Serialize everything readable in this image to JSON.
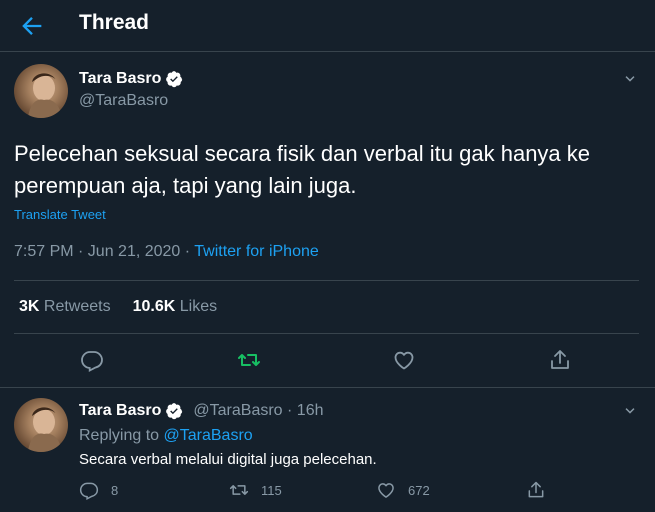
{
  "header": {
    "title": "Thread"
  },
  "main_tweet": {
    "display_name": "Tara Basro",
    "handle": "@TaraBasro",
    "text": "Pelecehan seksual secara fisik dan verbal itu gak hanya ke perempuan aja, tapi yang lain juga.",
    "translate_label": "Translate Tweet",
    "timestamp": "7:57 PM · Jun 21, 2020",
    "separator": " · ",
    "source": "Twitter for iPhone",
    "retweets_count": "3K",
    "retweets_label": "Retweets",
    "likes_count": "10.6K",
    "likes_label": "Likes"
  },
  "reply_tweet": {
    "display_name": "Tara Basro",
    "handle_time": "@TaraBasro · 16h",
    "replying_prefix": "Replying to ",
    "replying_mention": "@TaraBasro",
    "text": "Secara verbal melalui digital juga pelecehan.",
    "reply_count": "8",
    "retweet_count": "115",
    "like_count": "672"
  },
  "colors": {
    "background": "#15202b",
    "accent": "#1da1f2",
    "retweeted": "#17bf63",
    "muted": "#8899a6",
    "divider": "#38444d"
  },
  "icons": [
    "back-arrow-icon",
    "verified-badge-icon",
    "chevron-down-icon",
    "reply-icon",
    "retweet-icon",
    "like-icon",
    "share-icon"
  ]
}
